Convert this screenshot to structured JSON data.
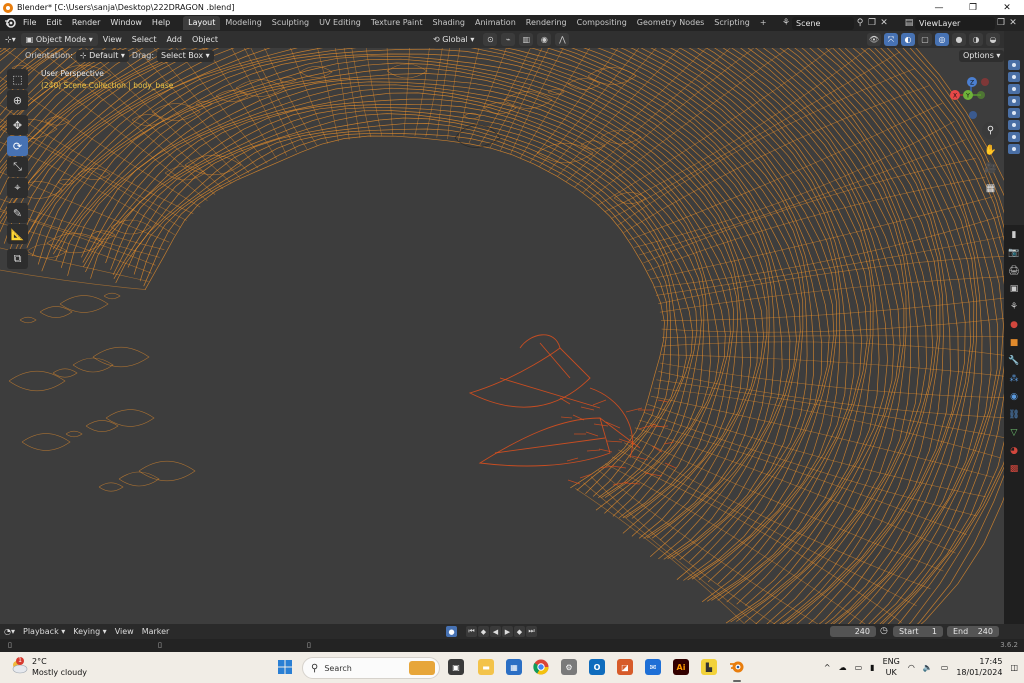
{
  "window": {
    "title": "Blender* [C:\\Users\\sanja\\Desktop\\222DRAGON .blend]",
    "controls": [
      "—",
      "❐",
      "✕"
    ]
  },
  "menubar": {
    "menus": [
      "File",
      "Edit",
      "Render",
      "Window",
      "Help"
    ],
    "workspaces": [
      "Layout",
      "Modeling",
      "Sculpting",
      "UV Editing",
      "Texture Paint",
      "Shading",
      "Animation",
      "Rendering",
      "Compositing",
      "Geometry Nodes",
      "Scripting"
    ],
    "active_workspace": "Layout",
    "add_tab": "+",
    "scene": "Scene",
    "view_layer": "ViewLayer"
  },
  "viewport_header": {
    "mode": "Object Mode",
    "menus": [
      "View",
      "Select",
      "Add",
      "Object"
    ],
    "transform_orientation": "Global"
  },
  "tool_settings": {
    "orientation_label": "Orientation:",
    "orientation_value": "Default",
    "drag_label": "Drag:",
    "drag_value": "Select Box",
    "options": "Options"
  },
  "viewport": {
    "perspective": "User Perspective",
    "collection_info": "(240) Scene Collection | body_base",
    "wire_color": "#f0932b",
    "selected_wire_color": "#e0501c",
    "background": "#3d3d3d"
  },
  "gizmo": {
    "x_label": "X",
    "y_label": "Y",
    "z_label": "Z",
    "x_color": "#e84848",
    "y_color": "#6fb33a",
    "z_color": "#4b7fd1"
  },
  "timeline": {
    "menus": [
      "Playback",
      "Keying",
      "View",
      "Marker"
    ],
    "current_frame": "240",
    "start_label": "Start",
    "start_value": "1",
    "end_label": "End",
    "end_value": "240"
  },
  "status": {
    "version": "3.6.2"
  },
  "taskbar": {
    "temperature": "2°C",
    "weather": "Mostly cloudy",
    "weather_badge": "1",
    "search_placeholder": "Search",
    "language_top": "ENG",
    "language_bottom": "UK",
    "time": "17:45",
    "date": "18/01/2024",
    "tray_arrow": "^"
  }
}
